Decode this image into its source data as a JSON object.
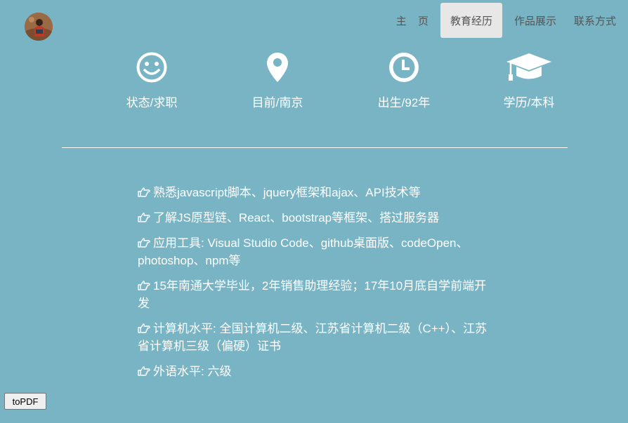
{
  "nav": {
    "items": [
      {
        "label": "主 页",
        "active": false
      },
      {
        "label": "教育经历",
        "active": true
      },
      {
        "label": "作品展示",
        "active": false
      },
      {
        "label": "联系方式",
        "active": false
      }
    ]
  },
  "info": [
    {
      "icon": "smiley-icon",
      "label": "状态/求职"
    },
    {
      "icon": "map-marker-icon",
      "label": "目前/南京"
    },
    {
      "icon": "clock-icon",
      "label": "出生/92年"
    },
    {
      "icon": "graduation-cap-icon",
      "label": "学历/本科"
    }
  ],
  "skills": [
    "熟悉javascript脚本、jquery框架和ajax、API技术等",
    "了解JS原型链、React、bootstrap等框架、搭过服务器",
    "应用工具: Visual Studio Code、github桌面版、codeOpen、photoshop、npm等",
    "15年南通大学毕业，2年销售助理经验；17年10月底自学前端开发",
    "计算机水平: 全国计算机二级、江苏省计算机二级（C++）、江苏省计算机三级（偏硬）证书",
    "外语水平: 六级"
  ],
  "skill_icon": "hand-point-right-icon",
  "topdf_label": "toPDF",
  "colors": {
    "background": "#79b4c5",
    "active_tab": "#e7e7e7",
    "nav_text": "#555555",
    "text": "#ffffff"
  }
}
